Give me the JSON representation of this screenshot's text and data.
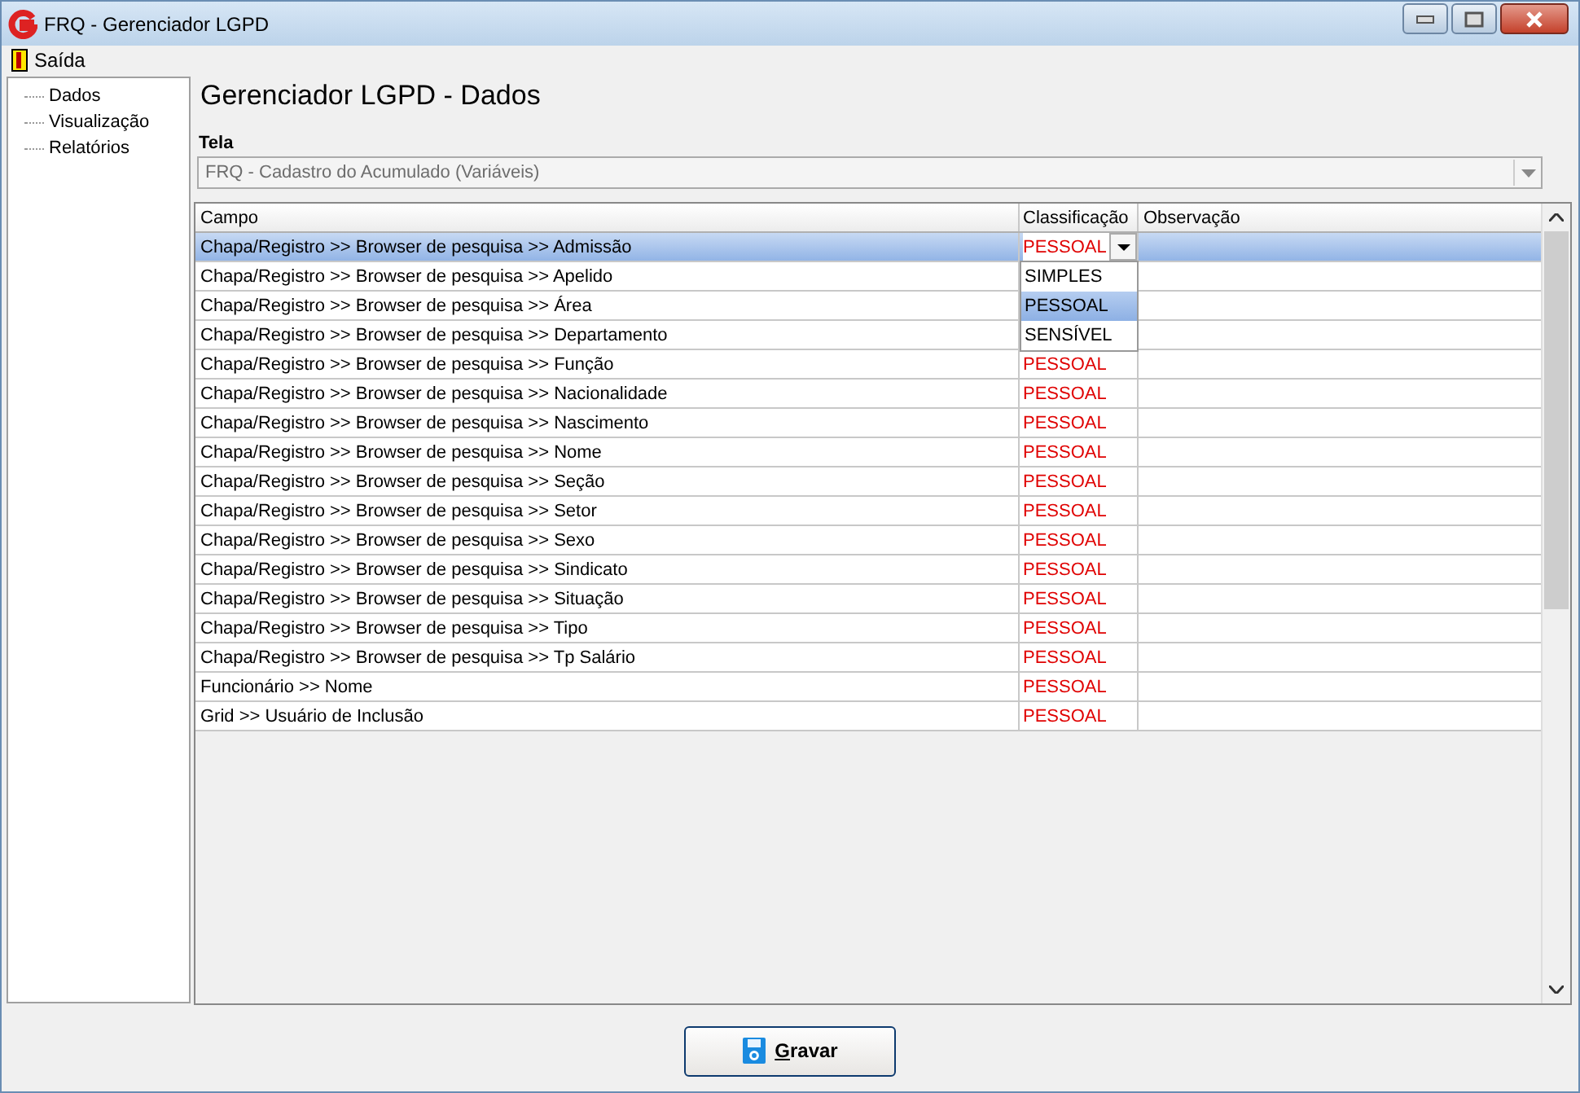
{
  "window": {
    "title": "FRQ - Gerenciador LGPD"
  },
  "menu": [
    {
      "label": "Saída"
    }
  ],
  "tree": [
    {
      "label": "Dados",
      "selected": false
    },
    {
      "label": "Visualização",
      "selected": false
    },
    {
      "label": "Relatórios",
      "selected": false
    }
  ],
  "heading": "Gerenciador LGPD - Dados",
  "screen_field": {
    "label": "Tela",
    "value": "FRQ - Cadastro do Acumulado (Variáveis)",
    "disabled": true
  },
  "table": {
    "columns": [
      "Campo",
      "Classificação",
      "Observação"
    ],
    "rows": [
      {
        "campo": "Chapa/Registro >> Browser de pesquisa >> Admissão",
        "classificacao": "PESSOAL",
        "selected": true,
        "editing": true
      },
      {
        "campo": "Chapa/Registro >> Browser de pesquisa >> Apelido",
        "selected": false
      },
      {
        "campo": "Chapa/Registro >> Browser de pesquisa >> Área",
        "selected": false
      },
      {
        "campo": "Chapa/Registro >> Browser de pesquisa >> Departamento",
        "selected": false
      },
      {
        "campo": "Chapa/Registro >> Browser de pesquisa >> Função",
        "classificacao": "PESSOAL",
        "selected": false
      },
      {
        "campo": "Chapa/Registro >> Browser de pesquisa >> Nacionalidade",
        "classificacao": "PESSOAL",
        "selected": false
      },
      {
        "campo": "Chapa/Registro >> Browser de pesquisa >> Nascimento",
        "classificacao": "PESSOAL",
        "selected": false
      },
      {
        "campo": "Chapa/Registro >> Browser de pesquisa >> Nome",
        "classificacao": "PESSOAL",
        "selected": false
      },
      {
        "campo": "Chapa/Registro >> Browser de pesquisa >> Seção",
        "classificacao": "PESSOAL",
        "selected": false
      },
      {
        "campo": "Chapa/Registro >> Browser de pesquisa >> Setor",
        "classificacao": "PESSOAL",
        "selected": false
      },
      {
        "campo": "Chapa/Registro >> Browser de pesquisa >> Sexo",
        "classificacao": "PESSOAL",
        "selected": false
      },
      {
        "campo": "Chapa/Registro >> Browser de pesquisa >> Sindicato",
        "classificacao": "PESSOAL",
        "selected": false
      },
      {
        "campo": "Chapa/Registro >> Browser de pesquisa >> Situação",
        "classificacao": "PESSOAL",
        "selected": false
      },
      {
        "campo": "Chapa/Registro >> Browser de pesquisa >> Tipo",
        "classificacao": "PESSOAL",
        "selected": false
      },
      {
        "campo": "Chapa/Registro >> Browser de pesquisa >> Tp Salário",
        "classificacao": "PESSOAL",
        "selected": false
      },
      {
        "campo": "Funcionário >> Nome",
        "classificacao": "PESSOAL",
        "selected": false
      },
      {
        "campo": "Grid >> Usuário de Inclusão",
        "classificacao": "PESSOAL",
        "selected": false
      }
    ]
  },
  "dropdown": {
    "options": [
      {
        "label": "SIMPLES",
        "selected": false
      },
      {
        "label": "PESSOAL",
        "selected": true
      },
      {
        "label": "SENSÍVEL",
        "selected": false
      }
    ]
  },
  "buttons": [
    {
      "label": "Gravar"
    }
  ]
}
